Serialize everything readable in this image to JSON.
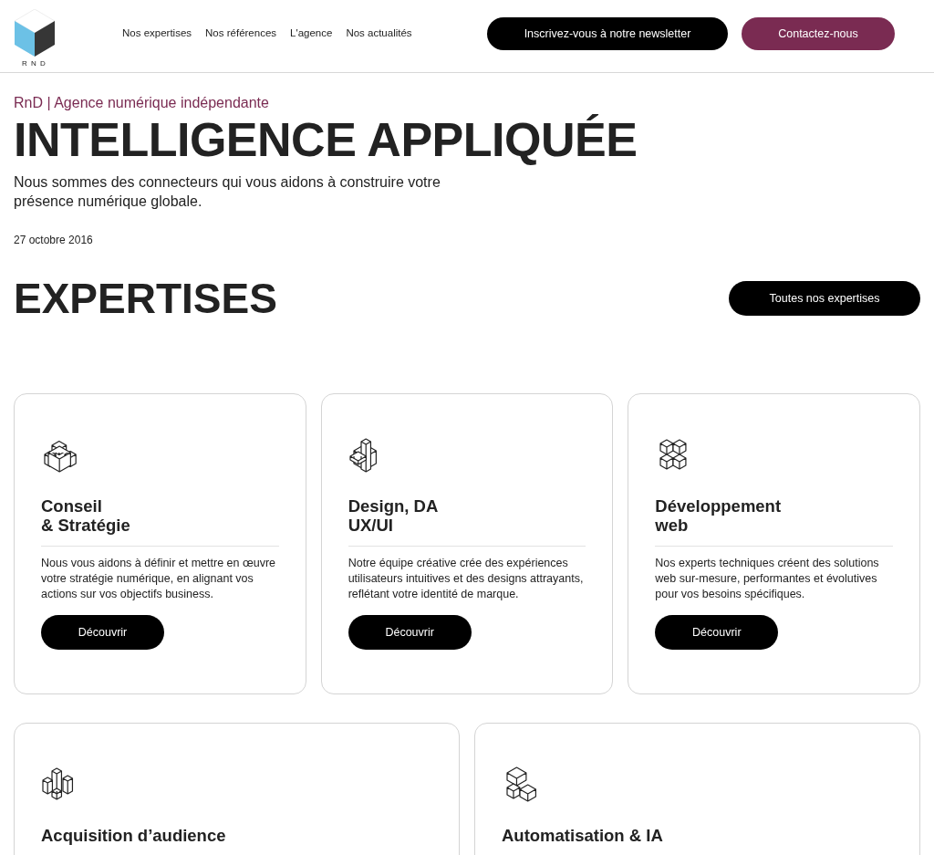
{
  "header": {
    "logo_text": "R N D",
    "nav": [
      "Nos expertises",
      "Nos références",
      "L'agence",
      "Nos actualités"
    ],
    "newsletter_button": "Inscrivez-vous à notre newsletter",
    "contact_button": "Contactez-nous"
  },
  "hero": {
    "eyebrow": "RnD | Agence numérique indépendante",
    "title": "INTELLIGENCE APPLIQUÉE",
    "lead": "Nous sommes des connecteurs qui vous aidons à construire votre présence numérique globale.",
    "date": "27 octobre 2016"
  },
  "expertises": {
    "title": "EXPERTISES",
    "all_button": "Toutes nos expertises",
    "cards": [
      {
        "kind": "strategy",
        "title": [
          "Conseil",
          "& Stratégie"
        ],
        "text": "Nous vous aidons à définir et mettre en œuvre votre stratégie numérique, en alignant vos actions sur vos objectifs business.",
        "button": "Découvrir"
      },
      {
        "kind": "design",
        "title": [
          "Design, DA",
          "UX/UI"
        ],
        "text": "Notre équipe créative crée des expériences utilisateurs intuitives et des designs attrayants, reflétant votre identité de marque.",
        "button": "Découvrir"
      },
      {
        "kind": "dev",
        "title": [
          "Développement",
          "web"
        ],
        "text": "Nos experts techniques créent des solutions web sur-mesure, performantes et évolutives pour vos besoins spécifiques.",
        "button": "Découvrir"
      },
      {
        "kind": "audience",
        "title": [
          "Acquisition d’audience"
        ]
      },
      {
        "kind": "automation",
        "title": [
          "Automatisation & IA"
        ]
      }
    ]
  }
}
